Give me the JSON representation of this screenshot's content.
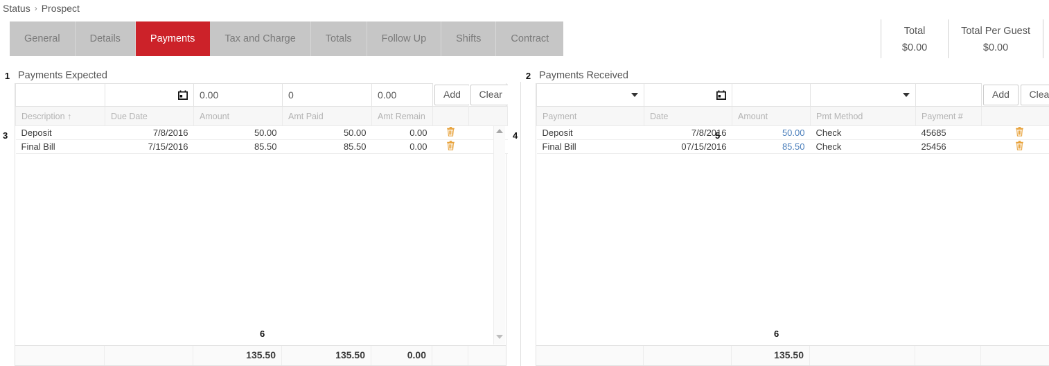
{
  "breadcrumb": {
    "items": [
      "Status",
      "Prospect"
    ],
    "separator": "›"
  },
  "tabs": [
    {
      "label": "General",
      "active": false
    },
    {
      "label": "Details",
      "active": false
    },
    {
      "label": "Payments",
      "active": true
    },
    {
      "label": "Tax and Charge",
      "active": false
    },
    {
      "label": "Totals",
      "active": false
    },
    {
      "label": "Follow Up",
      "active": false
    },
    {
      "label": "Shifts",
      "active": false
    },
    {
      "label": "Contract",
      "active": false
    }
  ],
  "totals_header": [
    {
      "label": "Total",
      "value": "$0.00"
    },
    {
      "label": "Total Per Guest",
      "value": "$0.00"
    }
  ],
  "colors": {
    "active_tab_bg": "#cc2229",
    "tab_bg": "#c6c6c6",
    "link": "#4a7ebb",
    "trash": "#e8a33d"
  },
  "payments_expected": {
    "callout": "1",
    "title": "Payments Expected",
    "rows_callout": "3",
    "scroll_callout": "4",
    "footer_callout": "6",
    "entry_row": {
      "description": "",
      "due_date": "",
      "due_date_icon": "calendar-icon",
      "amount": "0.00",
      "amt_paid": "0",
      "amt_remain": "0.00",
      "add_label": "Add",
      "clear_label": "Clear"
    },
    "columns": [
      "Description ↑",
      "Due Date",
      "Amount",
      "Amt Paid",
      "Amt Remain",
      ""
    ],
    "rows": [
      {
        "description": "Deposit",
        "due_date": "7/8/2016",
        "amount": "50.00",
        "amt_paid": "50.00",
        "amt_remain": "0.00",
        "delete_icon": "trash-icon"
      },
      {
        "description": "Final Bill",
        "due_date": "7/15/2016",
        "amount": "85.50",
        "amt_paid": "85.50",
        "amt_remain": "0.00",
        "delete_icon": "trash-icon"
      }
    ],
    "footer": {
      "amount": "135.50",
      "amt_paid": "135.50",
      "amt_remain": "0.00"
    }
  },
  "payments_received": {
    "callout": "2",
    "title": "Payments Received",
    "amount_callout": "5",
    "footer_callout": "6",
    "entry_row": {
      "payment": "",
      "payment_icon": "chevron-down-icon",
      "date": "",
      "date_icon": "calendar-icon",
      "amount": "",
      "pmt_method": "",
      "pmt_method_icon": "chevron-down-icon",
      "payment_number": "",
      "add_label": "Add",
      "clear_label": "Clear"
    },
    "columns": [
      "Payment",
      "Date",
      "Amount",
      "Pmt Method",
      "Payment #",
      ""
    ],
    "rows": [
      {
        "payment": "Deposit",
        "date": "7/8/2016",
        "amount": "50.00",
        "pmt_method": "Check",
        "payment_number": "45685",
        "delete_icon": "trash-icon"
      },
      {
        "payment": "Final Bill",
        "date": "07/15/2016",
        "amount": "85.50",
        "pmt_method": "Check",
        "payment_number": "25456",
        "delete_icon": "trash-icon"
      }
    ],
    "footer": {
      "amount": "135.50"
    }
  }
}
